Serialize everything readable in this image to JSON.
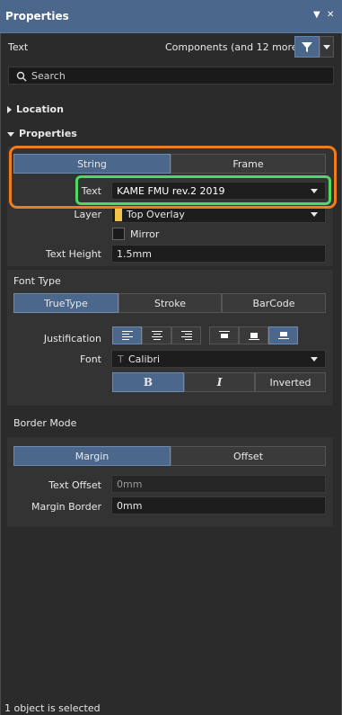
{
  "panel": {
    "title": "Properties",
    "pin_icon": "pin-icon",
    "close_icon": "close-icon"
  },
  "header": {
    "kind": "Text",
    "filter_scope": "Components (and 12 more)"
  },
  "search": {
    "placeholder": "Search"
  },
  "sections": {
    "location": "Location",
    "properties": "Properties"
  },
  "mode_tabs": {
    "string": "String",
    "frame": "Frame"
  },
  "text_field": {
    "label": "Text",
    "value": "KAME FMU rev.2 2019"
  },
  "layer": {
    "label": "Layer",
    "value": "Top Overlay",
    "swatch_color": "#f0c34b"
  },
  "mirror": {
    "label": "Mirror",
    "checked": false
  },
  "text_height": {
    "label": "Text Height",
    "value": "1.5mm"
  },
  "font_type": {
    "title": "Font Type",
    "options": [
      "TrueType",
      "Stroke",
      "BarCode"
    ],
    "selected": "TrueType"
  },
  "justification": {
    "label": "Justification"
  },
  "font": {
    "label": "Font",
    "value": "Calibri",
    "bold": "B",
    "italic": "I",
    "inverted": "Inverted"
  },
  "border_mode": {
    "title": "Border Mode",
    "options": [
      "Margin",
      "Offset"
    ],
    "selected": "Margin"
  },
  "text_offset": {
    "label": "Text Offset",
    "placeholder": "0mm"
  },
  "margin_border": {
    "label": "Margin Border",
    "value": "0mm"
  },
  "status": {
    "text": "1 object is selected"
  },
  "colors": {
    "accent": "#4b678b",
    "highlight_orange": "#f07d1a",
    "highlight_green": "#4cd964"
  }
}
